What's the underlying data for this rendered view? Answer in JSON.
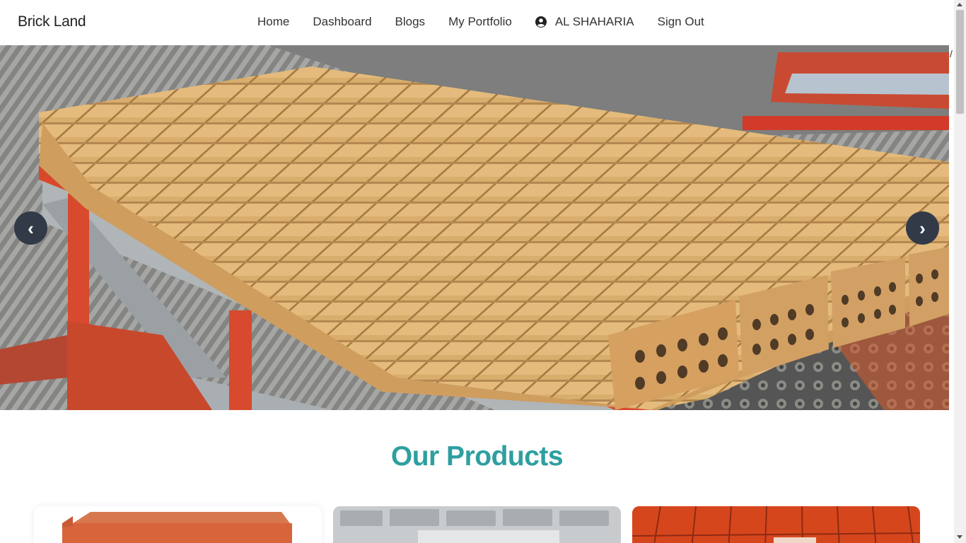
{
  "navbar": {
    "brand": "Brick Land",
    "links": [
      "Home",
      "Dashboard",
      "Blogs",
      "My Portfolio"
    ],
    "user_name": "AL SHAHARIA",
    "sign_out": "Sign Out"
  },
  "hero": {
    "prev_label": "‹",
    "next_label": "›",
    "stray_text": "/"
  },
  "products": {
    "title": "Our Products"
  },
  "colors": {
    "accent": "#2e9f9f",
    "slider_button": "#323a48"
  },
  "icons": {
    "user": "user-circle-icon"
  }
}
